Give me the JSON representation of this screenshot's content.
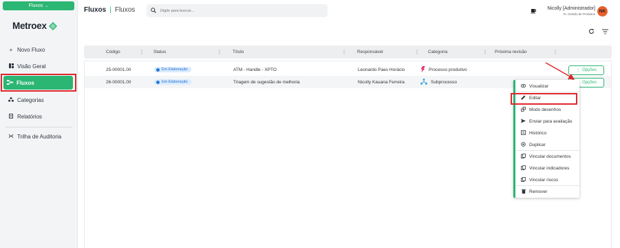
{
  "sidebar": {
    "module_label": "Fluxos",
    "logo_text": "Metroex",
    "items": [
      {
        "icon": "plus-icon",
        "label": "Novo Fluxo"
      },
      {
        "icon": "dashboard-icon",
        "label": "Visão Geral"
      },
      {
        "icon": "flow-icon",
        "label": "Fluxos",
        "active": true
      },
      {
        "icon": "categories-icon",
        "label": "Categorias"
      },
      {
        "icon": "report-icon",
        "label": "Relatórios"
      },
      {
        "icon": "audit-icon",
        "label": "Trilha de Auditoria"
      }
    ]
  },
  "header": {
    "title": "Fluxos",
    "subtitle": "Fluxos",
    "search_placeholder": "Digite para buscar...",
    "user_name": "Nicolly [Administrador]",
    "user_role": "FL Gestão de Produtos",
    "avatar_initials": "NK"
  },
  "table": {
    "columns": [
      "Código",
      "Status",
      "Título",
      "Responsável",
      "Categoria",
      "Próxima revisão"
    ],
    "rows": [
      {
        "code": "25-00001.00",
        "status": "Em Elaboração",
        "title": "ATM - Handle - XPTO",
        "owner": "Leonardo Paes Horácio",
        "category": "Processo produtivo",
        "category_icon": "lightning-icon",
        "next_review": "",
        "options_label": "Opções"
      },
      {
        "code": "26-00001.00",
        "status": "Em Elaboração",
        "title": "Triagem de sugestão de melhoria",
        "owner": "Nicolly Kauana Ferreira",
        "category": "Subprocesso",
        "category_icon": "subprocess-icon",
        "next_review": "",
        "options_label": "Opções"
      }
    ]
  },
  "context_menu": {
    "items": [
      {
        "icon": "eye-icon",
        "label": "Visualizar"
      },
      {
        "icon": "pencil-icon",
        "label": "Editar",
        "highlighted": true
      },
      {
        "icon": "draw-mode-icon",
        "label": "Modo desenhos"
      },
      {
        "icon": "send-icon",
        "label": "Enviar para avaliação"
      },
      {
        "icon": "history-icon",
        "label": "Histórico"
      },
      {
        "icon": "duplicate-icon",
        "label": "Duplicar"
      },
      {
        "icon": "link-doc-icon",
        "label": "Vincular documentos"
      },
      {
        "icon": "link-indicator-icon",
        "label": "Vincular indicadores"
      },
      {
        "icon": "link-risk-icon",
        "label": "Vincular riscos"
      },
      {
        "icon": "trash-icon",
        "label": "Remover"
      }
    ]
  },
  "colors": {
    "accent": "#2bb673",
    "highlight": "#e0262b",
    "status_badge_bg": "#d9ebff",
    "status_badge_text": "#2a6fc7"
  }
}
